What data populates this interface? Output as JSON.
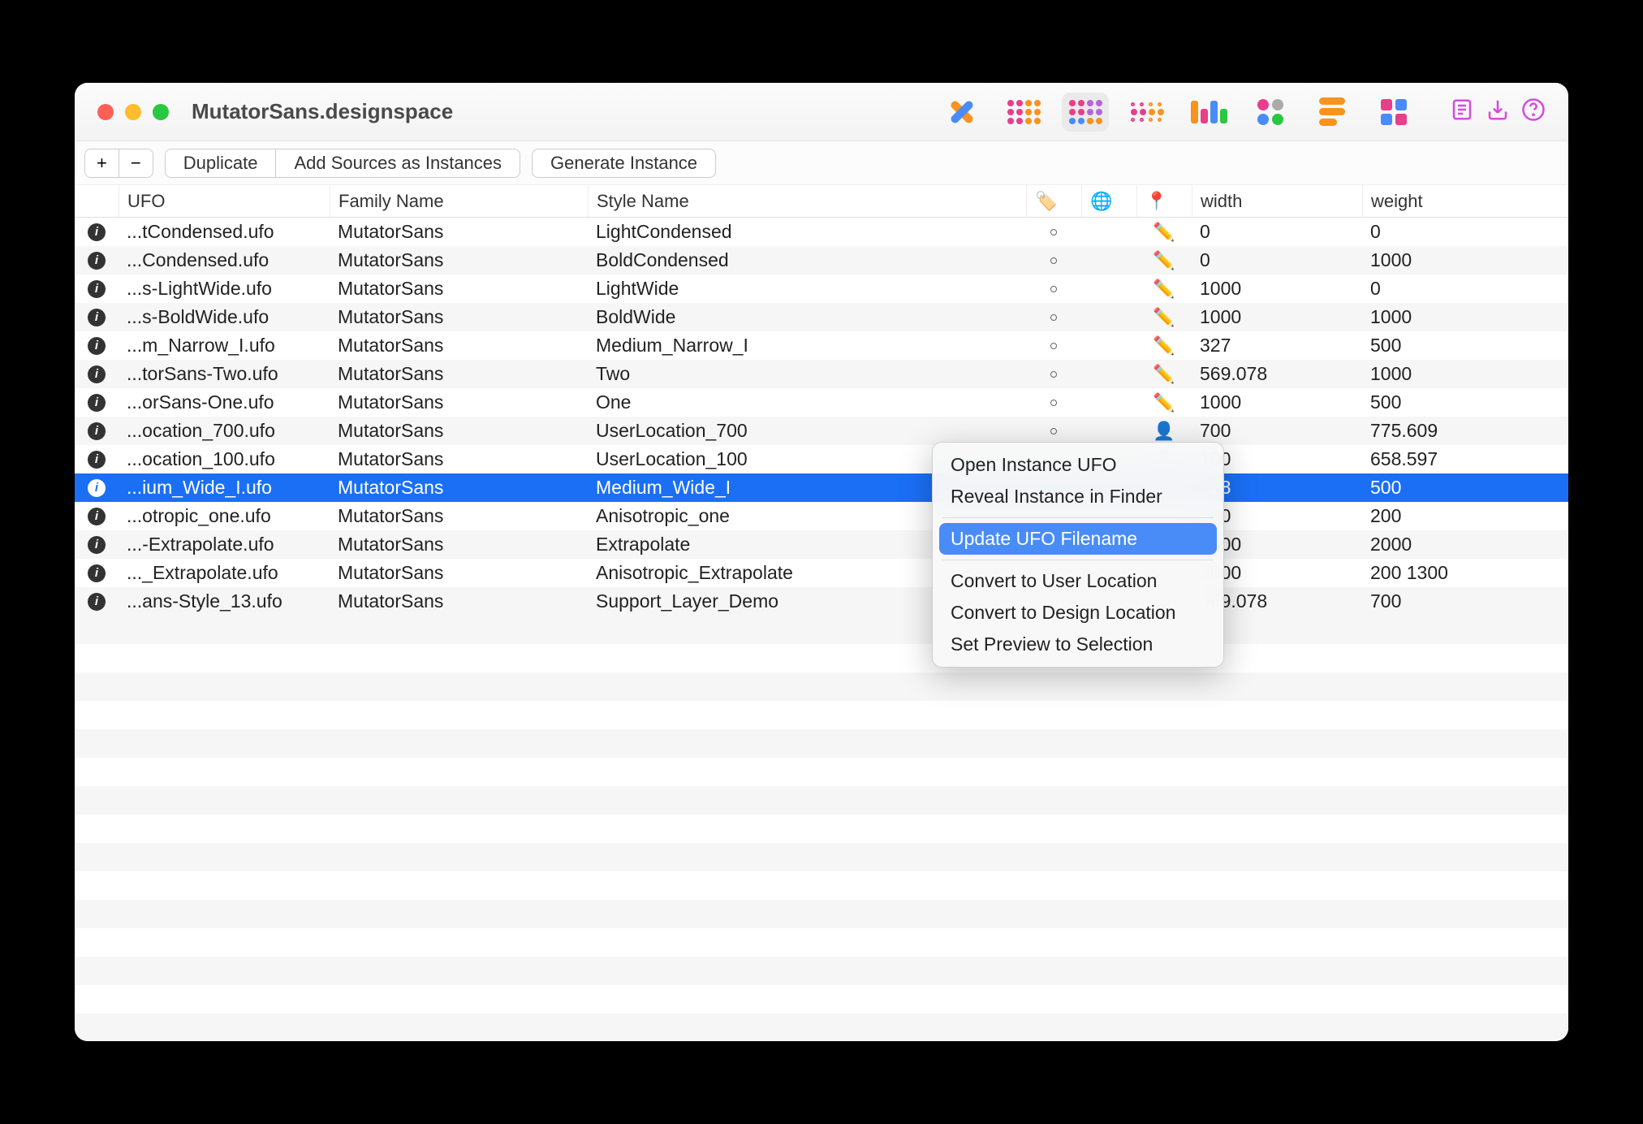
{
  "window": {
    "title": "MutatorSans.designspace"
  },
  "buttons": {
    "plus": "+",
    "minus": "−",
    "duplicate": "Duplicate",
    "add_sources": "Add Sources as Instances",
    "generate": "Generate Instance"
  },
  "columns": {
    "ufo": "UFO",
    "family": "Family Name",
    "style": "Style Name",
    "width": "width",
    "weight": "weight"
  },
  "rows": [
    {
      "ufo": "...tCondensed.ufo",
      "family": "MutatorSans",
      "style": "LightCondensed",
      "dot": true,
      "pencil": true,
      "width": "0",
      "weight": "0"
    },
    {
      "ufo": "...Condensed.ufo",
      "family": "MutatorSans",
      "style": "BoldCondensed",
      "dot": true,
      "pencil": true,
      "width": "0",
      "weight": "1000"
    },
    {
      "ufo": "...s-LightWide.ufo",
      "family": "MutatorSans",
      "style": "LightWide",
      "dot": true,
      "pencil": true,
      "width": "1000",
      "weight": "0"
    },
    {
      "ufo": "...s-BoldWide.ufo",
      "family": "MutatorSans",
      "style": "BoldWide",
      "dot": true,
      "pencil": true,
      "width": "1000",
      "weight": "1000"
    },
    {
      "ufo": "...m_Narrow_I.ufo",
      "family": "MutatorSans",
      "style": "Medium_Narrow_I",
      "dot": true,
      "pencil": true,
      "width": "327",
      "weight": "500"
    },
    {
      "ufo": "...torSans-Two.ufo",
      "family": "MutatorSans",
      "style": "Two",
      "dot": true,
      "pencil": true,
      "width": "569.078",
      "weight": "1000"
    },
    {
      "ufo": "...orSans-One.ufo",
      "family": "MutatorSans",
      "style": "One",
      "dot": true,
      "pencil": true,
      "width": "1000",
      "weight": "500"
    },
    {
      "ufo": "...ocation_700.ufo",
      "family": "MutatorSans",
      "style": "UserLocation_700",
      "dot": true,
      "person": true,
      "width": "700",
      "weight": "775.609"
    },
    {
      "ufo": "...ocation_100.ufo",
      "family": "MutatorSans",
      "style": "UserLocation_100",
      "dot": false,
      "person": true,
      "width": "100",
      "weight": "658.597"
    },
    {
      "ufo": "...ium_Wide_I.ufo",
      "family": "MutatorSans",
      "style": "Medium_Wide_I",
      "dot": true,
      "pencil": true,
      "width": "328",
      "weight": "500",
      "selected": true
    },
    {
      "ufo": "...otropic_one.ufo",
      "family": "MutatorSans",
      "style": "Anisotropic_one",
      "dot": false,
      "width": "500",
      "weight": "200"
    },
    {
      "ufo": "...-Extrapolate.ufo",
      "family": "MutatorSans",
      "style": "Extrapolate",
      "dot": false,
      "width": "2000",
      "weight": "2000"
    },
    {
      "ufo": "..._Extrapolate.ufo",
      "family": "MutatorSans",
      "style": "Anisotropic_Extrapolate",
      "dot": false,
      "width": "2000",
      "weight": "200 1300"
    },
    {
      "ufo": "...ans-Style_13.ufo",
      "family": "MutatorSans",
      "style": "Support_Layer_Demo",
      "dot": false,
      "width": "569.078",
      "weight": "700"
    }
  ],
  "context_menu": {
    "open": "Open Instance UFO",
    "reveal": "Reveal Instance in Finder",
    "update": "Update UFO Filename",
    "convert_user": "Convert to User Location",
    "convert_design": "Convert to Design Location",
    "set_preview": "Set Preview to Selection"
  }
}
